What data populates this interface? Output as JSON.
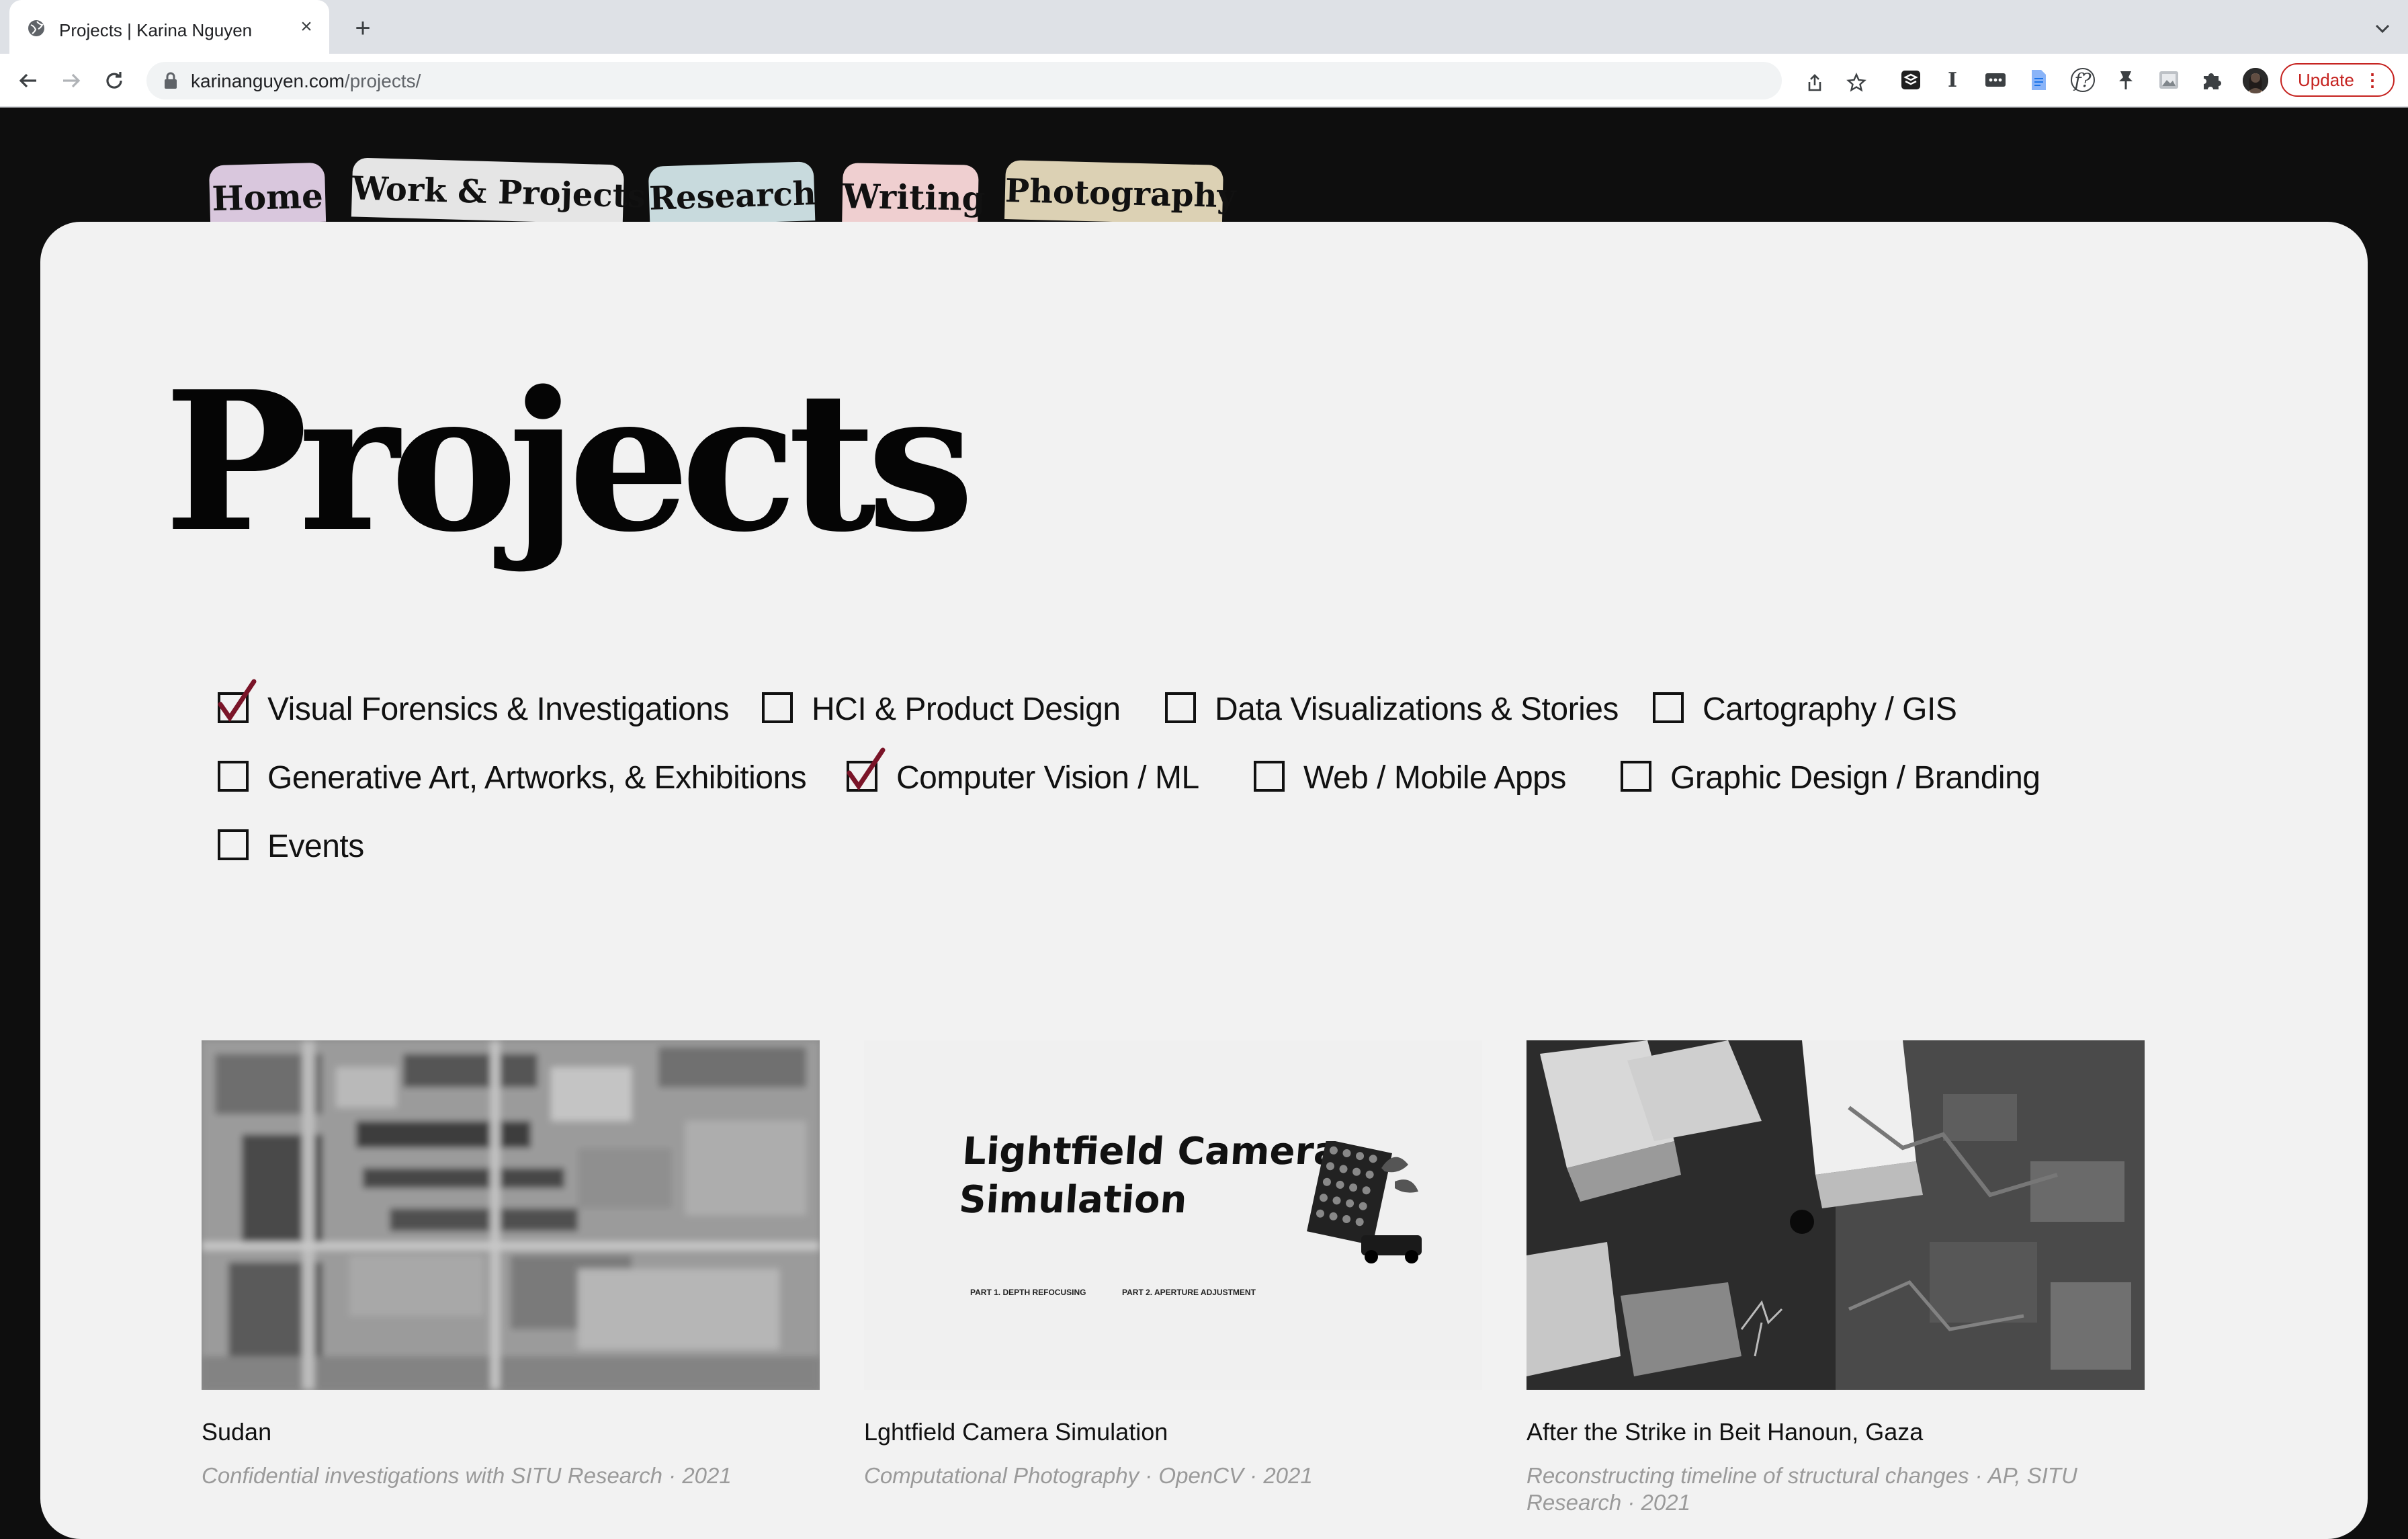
{
  "browser": {
    "tab_title": "Projects | Karina Nguyen",
    "tab_close": "×",
    "new_tab": "+",
    "url_domain": "karinanguyen.com",
    "url_path": "/projects/",
    "extensions": [
      "I",
      "f?"
    ],
    "update_label": "Update",
    "menu_dots": "⋮"
  },
  "nav": {
    "tabs": [
      {
        "label": "Home",
        "color": "#d9c7dd"
      },
      {
        "label": "Work & Projects",
        "color": "#e5e5e5"
      },
      {
        "label": "Research",
        "color": "#c8dadd"
      },
      {
        "label": "Writing",
        "color": "#efcfd0"
      },
      {
        "label": "Photography",
        "color": "#dcd1b4"
      }
    ]
  },
  "page": {
    "title": "Projects"
  },
  "filters": [
    {
      "label": "Visual Forensics & Investigations",
      "checked": true
    },
    {
      "label": "HCI & Product Design",
      "checked": false
    },
    {
      "label": "Data Visualizations & Stories",
      "checked": false
    },
    {
      "label": "Cartography / GIS",
      "checked": false
    },
    {
      "label": "Generative Art, Artworks, & Exhibitions",
      "checked": false
    },
    {
      "label": "Computer Vision / ML",
      "checked": true
    },
    {
      "label": "Web / Mobile Apps",
      "checked": false
    },
    {
      "label": "Graphic Design / Branding",
      "checked": false
    },
    {
      "label": "Events",
      "checked": false
    }
  ],
  "check_color": "#7a1428",
  "projects": [
    {
      "title": "Sudan",
      "subtitle": "Confidential investigations with SITU Research · 2021",
      "thumb_icon": "blurred-satellite-image"
    },
    {
      "title": "Lghtfield Camera Simulation",
      "subtitle": "Computational Photography · OpenCV · 2021",
      "thumb_icon": "lightfield-camera-poster",
      "thumb_heading_1": "Lightfield Camera",
      "thumb_heading_2": "Simulation",
      "thumb_part_1": "PART 1. DEPTH REFOCUSING",
      "thumb_part_2": "PART 2. APERTURE ADJUSTMENT"
    },
    {
      "title": "After the Strike in Beit Hanoun, Gaza",
      "subtitle": "Reconstructing timeline of structural changes · AP, SITU Research · 2021",
      "thumb_icon": "3d-reconstruction-aerial-image"
    }
  ]
}
